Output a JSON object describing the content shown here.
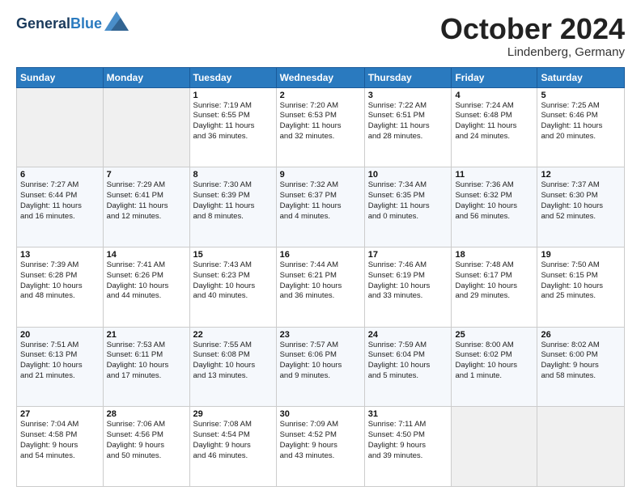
{
  "header": {
    "logo_line1": "General",
    "logo_line2": "Blue",
    "month": "October 2024",
    "location": "Lindenberg, Germany"
  },
  "weekdays": [
    "Sunday",
    "Monday",
    "Tuesday",
    "Wednesday",
    "Thursday",
    "Friday",
    "Saturday"
  ],
  "weeks": [
    [
      {
        "day": "",
        "info": ""
      },
      {
        "day": "",
        "info": ""
      },
      {
        "day": "1",
        "info": "Sunrise: 7:19 AM\nSunset: 6:55 PM\nDaylight: 11 hours\nand 36 minutes."
      },
      {
        "day": "2",
        "info": "Sunrise: 7:20 AM\nSunset: 6:53 PM\nDaylight: 11 hours\nand 32 minutes."
      },
      {
        "day": "3",
        "info": "Sunrise: 7:22 AM\nSunset: 6:51 PM\nDaylight: 11 hours\nand 28 minutes."
      },
      {
        "day": "4",
        "info": "Sunrise: 7:24 AM\nSunset: 6:48 PM\nDaylight: 11 hours\nand 24 minutes."
      },
      {
        "day": "5",
        "info": "Sunrise: 7:25 AM\nSunset: 6:46 PM\nDaylight: 11 hours\nand 20 minutes."
      }
    ],
    [
      {
        "day": "6",
        "info": "Sunrise: 7:27 AM\nSunset: 6:44 PM\nDaylight: 11 hours\nand 16 minutes."
      },
      {
        "day": "7",
        "info": "Sunrise: 7:29 AM\nSunset: 6:41 PM\nDaylight: 11 hours\nand 12 minutes."
      },
      {
        "day": "8",
        "info": "Sunrise: 7:30 AM\nSunset: 6:39 PM\nDaylight: 11 hours\nand 8 minutes."
      },
      {
        "day": "9",
        "info": "Sunrise: 7:32 AM\nSunset: 6:37 PM\nDaylight: 11 hours\nand 4 minutes."
      },
      {
        "day": "10",
        "info": "Sunrise: 7:34 AM\nSunset: 6:35 PM\nDaylight: 11 hours\nand 0 minutes."
      },
      {
        "day": "11",
        "info": "Sunrise: 7:36 AM\nSunset: 6:32 PM\nDaylight: 10 hours\nand 56 minutes."
      },
      {
        "day": "12",
        "info": "Sunrise: 7:37 AM\nSunset: 6:30 PM\nDaylight: 10 hours\nand 52 minutes."
      }
    ],
    [
      {
        "day": "13",
        "info": "Sunrise: 7:39 AM\nSunset: 6:28 PM\nDaylight: 10 hours\nand 48 minutes."
      },
      {
        "day": "14",
        "info": "Sunrise: 7:41 AM\nSunset: 6:26 PM\nDaylight: 10 hours\nand 44 minutes."
      },
      {
        "day": "15",
        "info": "Sunrise: 7:43 AM\nSunset: 6:23 PM\nDaylight: 10 hours\nand 40 minutes."
      },
      {
        "day": "16",
        "info": "Sunrise: 7:44 AM\nSunset: 6:21 PM\nDaylight: 10 hours\nand 36 minutes."
      },
      {
        "day": "17",
        "info": "Sunrise: 7:46 AM\nSunset: 6:19 PM\nDaylight: 10 hours\nand 33 minutes."
      },
      {
        "day": "18",
        "info": "Sunrise: 7:48 AM\nSunset: 6:17 PM\nDaylight: 10 hours\nand 29 minutes."
      },
      {
        "day": "19",
        "info": "Sunrise: 7:50 AM\nSunset: 6:15 PM\nDaylight: 10 hours\nand 25 minutes."
      }
    ],
    [
      {
        "day": "20",
        "info": "Sunrise: 7:51 AM\nSunset: 6:13 PM\nDaylight: 10 hours\nand 21 minutes."
      },
      {
        "day": "21",
        "info": "Sunrise: 7:53 AM\nSunset: 6:11 PM\nDaylight: 10 hours\nand 17 minutes."
      },
      {
        "day": "22",
        "info": "Sunrise: 7:55 AM\nSunset: 6:08 PM\nDaylight: 10 hours\nand 13 minutes."
      },
      {
        "day": "23",
        "info": "Sunrise: 7:57 AM\nSunset: 6:06 PM\nDaylight: 10 hours\nand 9 minutes."
      },
      {
        "day": "24",
        "info": "Sunrise: 7:59 AM\nSunset: 6:04 PM\nDaylight: 10 hours\nand 5 minutes."
      },
      {
        "day": "25",
        "info": "Sunrise: 8:00 AM\nSunset: 6:02 PM\nDaylight: 10 hours\nand 1 minute."
      },
      {
        "day": "26",
        "info": "Sunrise: 8:02 AM\nSunset: 6:00 PM\nDaylight: 9 hours\nand 58 minutes."
      }
    ],
    [
      {
        "day": "27",
        "info": "Sunrise: 7:04 AM\nSunset: 4:58 PM\nDaylight: 9 hours\nand 54 minutes."
      },
      {
        "day": "28",
        "info": "Sunrise: 7:06 AM\nSunset: 4:56 PM\nDaylight: 9 hours\nand 50 minutes."
      },
      {
        "day": "29",
        "info": "Sunrise: 7:08 AM\nSunset: 4:54 PM\nDaylight: 9 hours\nand 46 minutes."
      },
      {
        "day": "30",
        "info": "Sunrise: 7:09 AM\nSunset: 4:52 PM\nDaylight: 9 hours\nand 43 minutes."
      },
      {
        "day": "31",
        "info": "Sunrise: 7:11 AM\nSunset: 4:50 PM\nDaylight: 9 hours\nand 39 minutes."
      },
      {
        "day": "",
        "info": ""
      },
      {
        "day": "",
        "info": ""
      }
    ]
  ]
}
